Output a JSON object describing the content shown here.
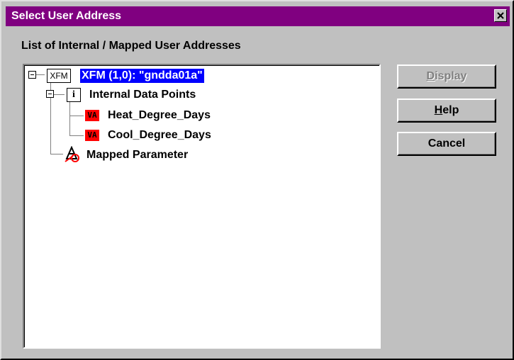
{
  "window": {
    "title": "Select User Address",
    "close_icon": "close-icon"
  },
  "list_label": "List of Internal / Mapped User Addresses",
  "tree": {
    "root": {
      "icon_text": "XFM",
      "label": "XFM (1,0): \"gndda01a\"",
      "selected": true,
      "expanded": true
    },
    "internal": {
      "icon_text": "i",
      "label": "Internal Data Points",
      "expanded": true
    },
    "points": [
      {
        "icon_text": "VA",
        "label": "Heat_Degree_Days"
      },
      {
        "icon_text": "VA",
        "label": "Cool_Degree_Days"
      }
    ],
    "mapped": {
      "icon": "mapped-parameter-icon",
      "label": "Mapped Parameter"
    }
  },
  "buttons": {
    "display": {
      "mnemonic": "D",
      "rest": "isplay",
      "enabled": false
    },
    "help": {
      "mnemonic": "H",
      "rest": "elp",
      "enabled": true
    },
    "cancel": {
      "label": "Cancel",
      "enabled": true
    }
  },
  "colors": {
    "titlebar": "#800080",
    "selection": "#0000ff",
    "va_badge": "#ff0000",
    "face": "#c0c0c0"
  }
}
